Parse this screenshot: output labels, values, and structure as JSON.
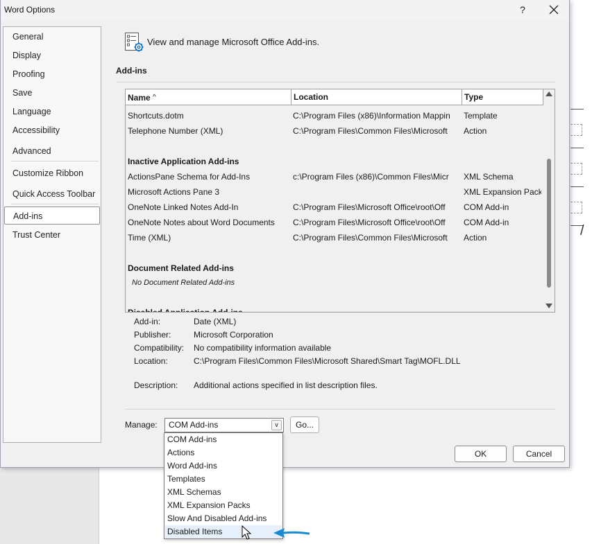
{
  "dialog": {
    "title": "Word Options",
    "help_label": "?",
    "icon_colors": {
      "accent": "#0067c0",
      "arrow": "#1a8ad4"
    }
  },
  "nav": {
    "items": [
      {
        "label": "General"
      },
      {
        "label": "Display"
      },
      {
        "label": "Proofing"
      },
      {
        "label": "Save"
      },
      {
        "label": "Language"
      },
      {
        "label": "Accessibility"
      },
      {
        "label": "Advanced"
      },
      {
        "label": "Customize Ribbon"
      },
      {
        "label": "Quick Access Toolbar"
      },
      {
        "label": "Add-ins",
        "selected": true
      },
      {
        "label": "Trust Center"
      }
    ]
  },
  "header": {
    "text": "View and manage Microsoft Office Add-ins.",
    "section_title": "Add-ins"
  },
  "list": {
    "columns": {
      "name": "Name",
      "sort_indicator": "^",
      "location": "Location",
      "type": "Type"
    },
    "rows_top": [
      {
        "name": "Shortcuts.dotm",
        "location": "C:\\Program Files (x86)\\Information Mappin",
        "type": "Template"
      },
      {
        "name": "Telephone Number (XML)",
        "location": "C:\\Program Files\\Common Files\\Microsoft",
        "type": "Action"
      }
    ],
    "group_inactive": "Inactive Application Add-ins",
    "rows_inactive": [
      {
        "name": "ActionsPane Schema for Add-Ins",
        "location": "c:\\Program Files (x86)\\Common Files\\Micr",
        "type": "XML Schema"
      },
      {
        "name": "Microsoft Actions Pane 3",
        "location": "",
        "type": "XML Expansion Pack"
      },
      {
        "name": "OneNote Linked Notes Add-In",
        "location": "C:\\Program Files\\Microsoft Office\\root\\Off",
        "type": "COM Add-in"
      },
      {
        "name": "OneNote Notes about Word Documents",
        "location": "C:\\Program Files\\Microsoft Office\\root\\Off",
        "type": "COM Add-in"
      },
      {
        "name": "Time (XML)",
        "location": "C:\\Program Files\\Common Files\\Microsoft",
        "type": "Action"
      }
    ],
    "group_document": "Document Related Add-ins",
    "document_empty": "No Document Related Add-ins",
    "group_disabled": "Disabled Application Add-ins"
  },
  "details": {
    "addin_label": "Add-in:",
    "addin_value": "Date (XML)",
    "publisher_label": "Publisher:",
    "publisher_value": "Microsoft Corporation",
    "compat_label": "Compatibility:",
    "compat_value": "No compatibility information available",
    "location_label": "Location:",
    "location_value": "C:\\Program Files\\Common Files\\Microsoft Shared\\Smart Tag\\MOFL.DLL",
    "description_label": "Description:",
    "description_value": "Additional actions specified in list description files."
  },
  "manage": {
    "label": "Manage:",
    "selected": "COM Add-ins",
    "go_label": "Go...",
    "options": [
      "COM Add-ins",
      "Actions",
      "Word Add-ins",
      "Templates",
      "XML Schemas",
      "XML Expansion Packs",
      "Slow And Disabled Add-ins",
      "Disabled Items"
    ],
    "hovered": "Disabled Items"
  },
  "buttons": {
    "ok_label": "OK",
    "cancel_label": "Cancel"
  }
}
